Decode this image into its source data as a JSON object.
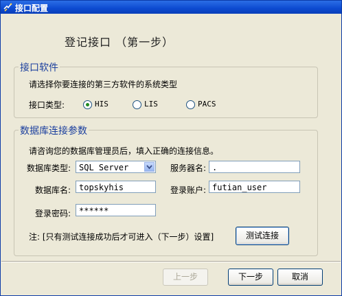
{
  "window": {
    "title": "接口配置"
  },
  "heading": "登记接口 （第一步）",
  "software_group": {
    "legend": "接口软件",
    "instruction": "请选择你要连接的第三方软件的系统类型",
    "type_label": "接口类型:",
    "options": [
      {
        "label": "HIS",
        "selected": true
      },
      {
        "label": "LIS",
        "selected": false
      },
      {
        "label": "PACS",
        "selected": false
      }
    ]
  },
  "db_group": {
    "legend": "数据库连接参数",
    "instruction": "请咨询您的数据库管理员后，填入正确的连接信息。",
    "db_type_label": "数据库类型:",
    "db_type_value": "SQL Server",
    "server_label": "服务器名:",
    "server_value": ".",
    "db_name_label": "数据库名:",
    "db_name_value": "topskyhis",
    "account_label": "登录账户:",
    "account_value": "futian_user",
    "password_label": "登录密码:",
    "password_value": "******",
    "note": "注:  [只有测试连接成功后才可进入（下一步）设置]",
    "test_button": "测试连接"
  },
  "footer": {
    "prev_button": "上一步",
    "next_button": "下一步",
    "cancel_button": "取消"
  },
  "colors": {
    "title_bar": "#0c4ad0",
    "legend_text": "#1b3f9e",
    "window_bg": "#ece9d8"
  }
}
